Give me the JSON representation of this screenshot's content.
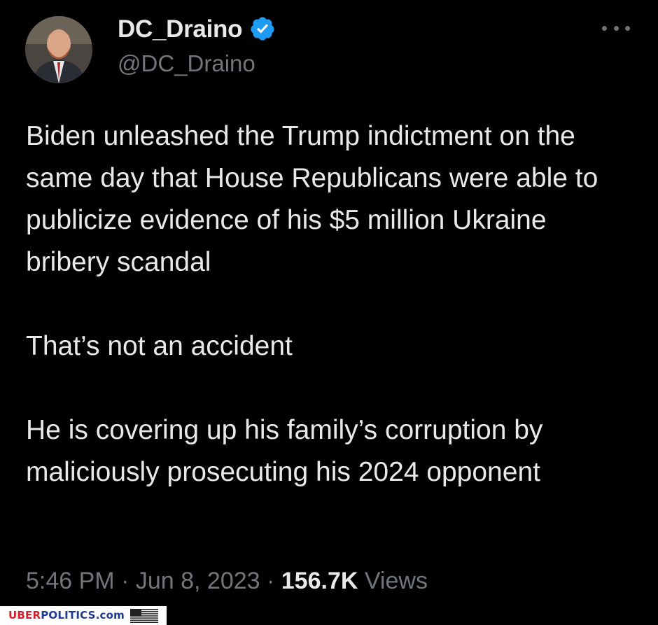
{
  "author": {
    "display_name": "DC_Draino",
    "handle": "@DC_Draino",
    "verified": true,
    "verified_color": "#1d9bf0"
  },
  "tweet": {
    "text": "Biden unleashed the Trump indictment on the same day that House Republicans were able to publicize evidence of his $5 million Ukraine bribery scandal\n\nThat’s not an accident\n\nHe is covering up his family’s corruption by maliciously prosecuting his 2024 opponent",
    "time": "5:46 PM",
    "date": "Jun 8, 2023",
    "views_count": "156.7K",
    "views_label": "Views"
  },
  "icons": {
    "more": "more-options-icon",
    "verified": "verified-badge-icon"
  },
  "watermark": {
    "part1": "UBER",
    "part2": "POLITICS.com"
  },
  "colors": {
    "background": "#000000",
    "text": "#e7e9ea",
    "secondary": "#71767b"
  }
}
